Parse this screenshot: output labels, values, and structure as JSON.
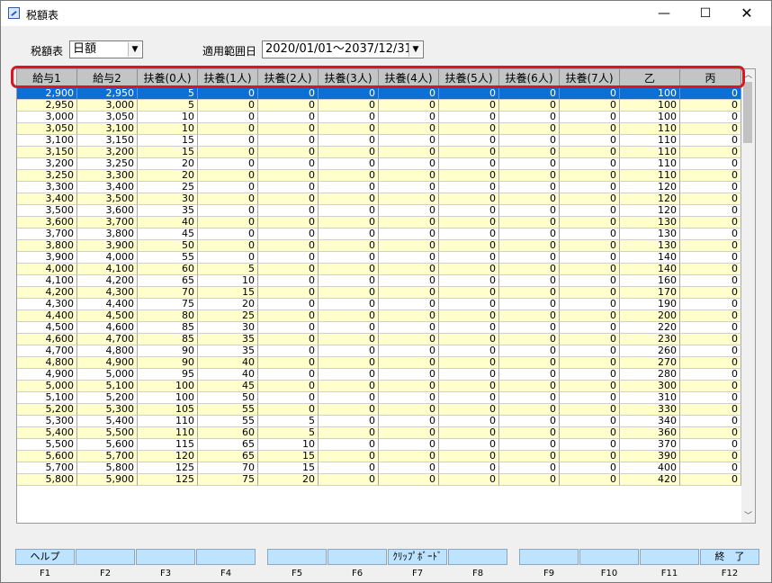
{
  "window": {
    "title": "税額表",
    "minimize": "—",
    "maximize": "☐",
    "close": "✕",
    "icon": "app-icon"
  },
  "filters": {
    "table_label": "税額表",
    "table_value": "日額",
    "range_label": "適用範囲日",
    "range_value": "2020/01/01〜2037/12/31"
  },
  "table": {
    "columns": [
      "給与1",
      "給与2",
      "扶養(0人)",
      "扶養(1人)",
      "扶養(2人)",
      "扶養(3人)",
      "扶養(4人)",
      "扶養(5人)",
      "扶養(6人)",
      "扶養(7人)",
      "乙",
      "丙"
    ],
    "rows": [
      [
        "2,900",
        "2,950",
        "5",
        "0",
        "0",
        "0",
        "0",
        "0",
        "0",
        "0",
        "100",
        "0"
      ],
      [
        "2,950",
        "3,000",
        "5",
        "0",
        "0",
        "0",
        "0",
        "0",
        "0",
        "0",
        "100",
        "0"
      ],
      [
        "3,000",
        "3,050",
        "10",
        "0",
        "0",
        "0",
        "0",
        "0",
        "0",
        "0",
        "100",
        "0"
      ],
      [
        "3,050",
        "3,100",
        "10",
        "0",
        "0",
        "0",
        "0",
        "0",
        "0",
        "0",
        "110",
        "0"
      ],
      [
        "3,100",
        "3,150",
        "15",
        "0",
        "0",
        "0",
        "0",
        "0",
        "0",
        "0",
        "110",
        "0"
      ],
      [
        "3,150",
        "3,200",
        "15",
        "0",
        "0",
        "0",
        "0",
        "0",
        "0",
        "0",
        "110",
        "0"
      ],
      [
        "3,200",
        "3,250",
        "20",
        "0",
        "0",
        "0",
        "0",
        "0",
        "0",
        "0",
        "110",
        "0"
      ],
      [
        "3,250",
        "3,300",
        "20",
        "0",
        "0",
        "0",
        "0",
        "0",
        "0",
        "0",
        "110",
        "0"
      ],
      [
        "3,300",
        "3,400",
        "25",
        "0",
        "0",
        "0",
        "0",
        "0",
        "0",
        "0",
        "120",
        "0"
      ],
      [
        "3,400",
        "3,500",
        "30",
        "0",
        "0",
        "0",
        "0",
        "0",
        "0",
        "0",
        "120",
        "0"
      ],
      [
        "3,500",
        "3,600",
        "35",
        "0",
        "0",
        "0",
        "0",
        "0",
        "0",
        "0",
        "120",
        "0"
      ],
      [
        "3,600",
        "3,700",
        "40",
        "0",
        "0",
        "0",
        "0",
        "0",
        "0",
        "0",
        "130",
        "0"
      ],
      [
        "3,700",
        "3,800",
        "45",
        "0",
        "0",
        "0",
        "0",
        "0",
        "0",
        "0",
        "130",
        "0"
      ],
      [
        "3,800",
        "3,900",
        "50",
        "0",
        "0",
        "0",
        "0",
        "0",
        "0",
        "0",
        "130",
        "0"
      ],
      [
        "3,900",
        "4,000",
        "55",
        "0",
        "0",
        "0",
        "0",
        "0",
        "0",
        "0",
        "140",
        "0"
      ],
      [
        "4,000",
        "4,100",
        "60",
        "5",
        "0",
        "0",
        "0",
        "0",
        "0",
        "0",
        "140",
        "0"
      ],
      [
        "4,100",
        "4,200",
        "65",
        "10",
        "0",
        "0",
        "0",
        "0",
        "0",
        "0",
        "160",
        "0"
      ],
      [
        "4,200",
        "4,300",
        "70",
        "15",
        "0",
        "0",
        "0",
        "0",
        "0",
        "0",
        "170",
        "0"
      ],
      [
        "4,300",
        "4,400",
        "75",
        "20",
        "0",
        "0",
        "0",
        "0",
        "0",
        "0",
        "190",
        "0"
      ],
      [
        "4,400",
        "4,500",
        "80",
        "25",
        "0",
        "0",
        "0",
        "0",
        "0",
        "0",
        "200",
        "0"
      ],
      [
        "4,500",
        "4,600",
        "85",
        "30",
        "0",
        "0",
        "0",
        "0",
        "0",
        "0",
        "220",
        "0"
      ],
      [
        "4,600",
        "4,700",
        "85",
        "35",
        "0",
        "0",
        "0",
        "0",
        "0",
        "0",
        "230",
        "0"
      ],
      [
        "4,700",
        "4,800",
        "90",
        "35",
        "0",
        "0",
        "0",
        "0",
        "0",
        "0",
        "260",
        "0"
      ],
      [
        "4,800",
        "4,900",
        "90",
        "40",
        "0",
        "0",
        "0",
        "0",
        "0",
        "0",
        "270",
        "0"
      ],
      [
        "4,900",
        "5,000",
        "95",
        "40",
        "0",
        "0",
        "0",
        "0",
        "0",
        "0",
        "280",
        "0"
      ],
      [
        "5,000",
        "5,100",
        "100",
        "45",
        "0",
        "0",
        "0",
        "0",
        "0",
        "0",
        "300",
        "0"
      ],
      [
        "5,100",
        "5,200",
        "100",
        "50",
        "0",
        "0",
        "0",
        "0",
        "0",
        "0",
        "310",
        "0"
      ],
      [
        "5,200",
        "5,300",
        "105",
        "55",
        "0",
        "0",
        "0",
        "0",
        "0",
        "0",
        "330",
        "0"
      ],
      [
        "5,300",
        "5,400",
        "110",
        "55",
        "5",
        "0",
        "0",
        "0",
        "0",
        "0",
        "340",
        "0"
      ],
      [
        "5,400",
        "5,500",
        "110",
        "60",
        "5",
        "0",
        "0",
        "0",
        "0",
        "0",
        "360",
        "0"
      ],
      [
        "5,500",
        "5,600",
        "115",
        "65",
        "10",
        "0",
        "0",
        "0",
        "0",
        "0",
        "370",
        "0"
      ],
      [
        "5,600",
        "5,700",
        "120",
        "65",
        "15",
        "0",
        "0",
        "0",
        "0",
        "0",
        "390",
        "0"
      ],
      [
        "5,700",
        "5,800",
        "125",
        "70",
        "15",
        "0",
        "0",
        "0",
        "0",
        "0",
        "400",
        "0"
      ],
      [
        "5,800",
        "5,900",
        "125",
        "75",
        "20",
        "0",
        "0",
        "0",
        "0",
        "0",
        "420",
        "0"
      ]
    ]
  },
  "function_keys": [
    {
      "key": "F1",
      "label": "ヘルプ"
    },
    {
      "key": "F2",
      "label": ""
    },
    {
      "key": "F3",
      "label": ""
    },
    {
      "key": "F4",
      "label": ""
    },
    {
      "key": "F5",
      "label": ""
    },
    {
      "key": "F6",
      "label": ""
    },
    {
      "key": "F7",
      "label": "ｸﾘｯﾌﾟﾎﾞｰﾄﾞ"
    },
    {
      "key": "F8",
      "label": ""
    },
    {
      "key": "F9",
      "label": ""
    },
    {
      "key": "F10",
      "label": ""
    },
    {
      "key": "F11",
      "label": ""
    },
    {
      "key": "F12",
      "label": "終　了"
    }
  ],
  "colors": {
    "selected_row": "#0a6fd6",
    "alt_row": "#ffffcc",
    "highlight_frame": "#e0141e",
    "fkey": "#bde3ff"
  }
}
